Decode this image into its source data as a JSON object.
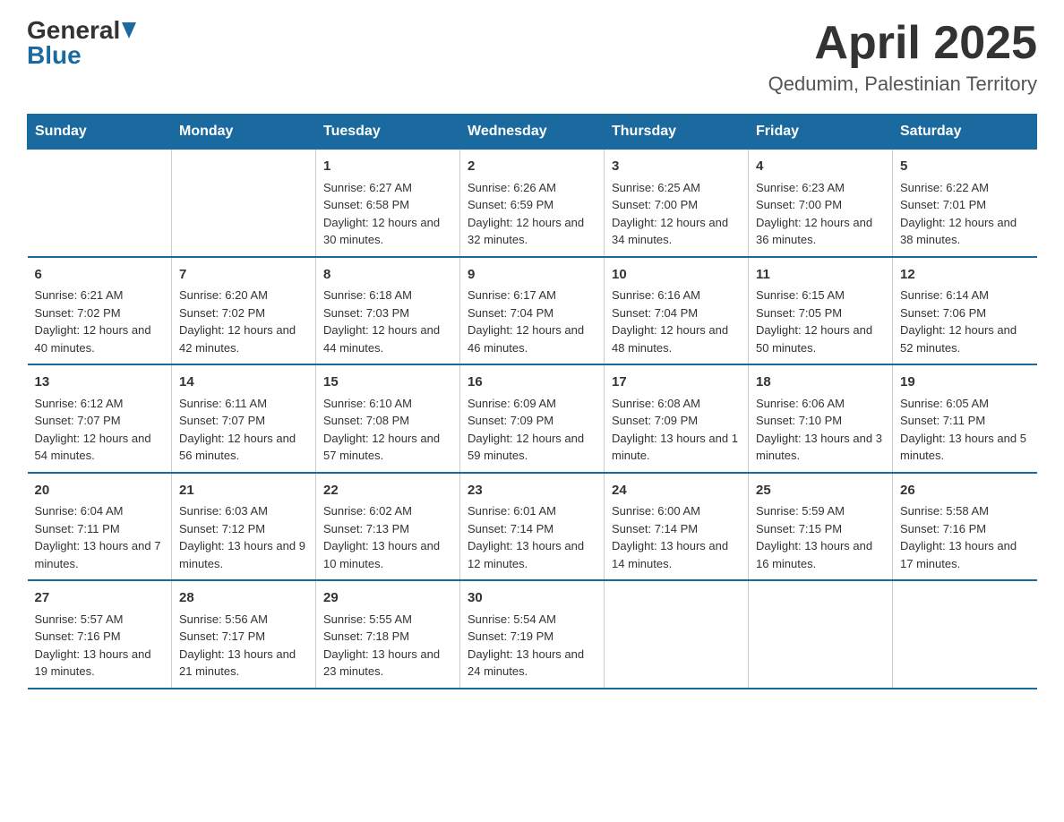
{
  "header": {
    "logo_general": "General",
    "logo_blue": "Blue",
    "month_title": "April 2025",
    "location": "Qedumim, Palestinian Territory"
  },
  "days_of_week": [
    "Sunday",
    "Monday",
    "Tuesday",
    "Wednesday",
    "Thursday",
    "Friday",
    "Saturday"
  ],
  "weeks": [
    [
      {
        "day": "",
        "info": ""
      },
      {
        "day": "",
        "info": ""
      },
      {
        "day": "1",
        "sunrise": "Sunrise: 6:27 AM",
        "sunset": "Sunset: 6:58 PM",
        "daylight": "Daylight: 12 hours and 30 minutes."
      },
      {
        "day": "2",
        "sunrise": "Sunrise: 6:26 AM",
        "sunset": "Sunset: 6:59 PM",
        "daylight": "Daylight: 12 hours and 32 minutes."
      },
      {
        "day": "3",
        "sunrise": "Sunrise: 6:25 AM",
        "sunset": "Sunset: 7:00 PM",
        "daylight": "Daylight: 12 hours and 34 minutes."
      },
      {
        "day": "4",
        "sunrise": "Sunrise: 6:23 AM",
        "sunset": "Sunset: 7:00 PM",
        "daylight": "Daylight: 12 hours and 36 minutes."
      },
      {
        "day": "5",
        "sunrise": "Sunrise: 6:22 AM",
        "sunset": "Sunset: 7:01 PM",
        "daylight": "Daylight: 12 hours and 38 minutes."
      }
    ],
    [
      {
        "day": "6",
        "sunrise": "Sunrise: 6:21 AM",
        "sunset": "Sunset: 7:02 PM",
        "daylight": "Daylight: 12 hours and 40 minutes."
      },
      {
        "day": "7",
        "sunrise": "Sunrise: 6:20 AM",
        "sunset": "Sunset: 7:02 PM",
        "daylight": "Daylight: 12 hours and 42 minutes."
      },
      {
        "day": "8",
        "sunrise": "Sunrise: 6:18 AM",
        "sunset": "Sunset: 7:03 PM",
        "daylight": "Daylight: 12 hours and 44 minutes."
      },
      {
        "day": "9",
        "sunrise": "Sunrise: 6:17 AM",
        "sunset": "Sunset: 7:04 PM",
        "daylight": "Daylight: 12 hours and 46 minutes."
      },
      {
        "day": "10",
        "sunrise": "Sunrise: 6:16 AM",
        "sunset": "Sunset: 7:04 PM",
        "daylight": "Daylight: 12 hours and 48 minutes."
      },
      {
        "day": "11",
        "sunrise": "Sunrise: 6:15 AM",
        "sunset": "Sunset: 7:05 PM",
        "daylight": "Daylight: 12 hours and 50 minutes."
      },
      {
        "day": "12",
        "sunrise": "Sunrise: 6:14 AM",
        "sunset": "Sunset: 7:06 PM",
        "daylight": "Daylight: 12 hours and 52 minutes."
      }
    ],
    [
      {
        "day": "13",
        "sunrise": "Sunrise: 6:12 AM",
        "sunset": "Sunset: 7:07 PM",
        "daylight": "Daylight: 12 hours and 54 minutes."
      },
      {
        "day": "14",
        "sunrise": "Sunrise: 6:11 AM",
        "sunset": "Sunset: 7:07 PM",
        "daylight": "Daylight: 12 hours and 56 minutes."
      },
      {
        "day": "15",
        "sunrise": "Sunrise: 6:10 AM",
        "sunset": "Sunset: 7:08 PM",
        "daylight": "Daylight: 12 hours and 57 minutes."
      },
      {
        "day": "16",
        "sunrise": "Sunrise: 6:09 AM",
        "sunset": "Sunset: 7:09 PM",
        "daylight": "Daylight: 12 hours and 59 minutes."
      },
      {
        "day": "17",
        "sunrise": "Sunrise: 6:08 AM",
        "sunset": "Sunset: 7:09 PM",
        "daylight": "Daylight: 13 hours and 1 minute."
      },
      {
        "day": "18",
        "sunrise": "Sunrise: 6:06 AM",
        "sunset": "Sunset: 7:10 PM",
        "daylight": "Daylight: 13 hours and 3 minutes."
      },
      {
        "day": "19",
        "sunrise": "Sunrise: 6:05 AM",
        "sunset": "Sunset: 7:11 PM",
        "daylight": "Daylight: 13 hours and 5 minutes."
      }
    ],
    [
      {
        "day": "20",
        "sunrise": "Sunrise: 6:04 AM",
        "sunset": "Sunset: 7:11 PM",
        "daylight": "Daylight: 13 hours and 7 minutes."
      },
      {
        "day": "21",
        "sunrise": "Sunrise: 6:03 AM",
        "sunset": "Sunset: 7:12 PM",
        "daylight": "Daylight: 13 hours and 9 minutes."
      },
      {
        "day": "22",
        "sunrise": "Sunrise: 6:02 AM",
        "sunset": "Sunset: 7:13 PM",
        "daylight": "Daylight: 13 hours and 10 minutes."
      },
      {
        "day": "23",
        "sunrise": "Sunrise: 6:01 AM",
        "sunset": "Sunset: 7:14 PM",
        "daylight": "Daylight: 13 hours and 12 minutes."
      },
      {
        "day": "24",
        "sunrise": "Sunrise: 6:00 AM",
        "sunset": "Sunset: 7:14 PM",
        "daylight": "Daylight: 13 hours and 14 minutes."
      },
      {
        "day": "25",
        "sunrise": "Sunrise: 5:59 AM",
        "sunset": "Sunset: 7:15 PM",
        "daylight": "Daylight: 13 hours and 16 minutes."
      },
      {
        "day": "26",
        "sunrise": "Sunrise: 5:58 AM",
        "sunset": "Sunset: 7:16 PM",
        "daylight": "Daylight: 13 hours and 17 minutes."
      }
    ],
    [
      {
        "day": "27",
        "sunrise": "Sunrise: 5:57 AM",
        "sunset": "Sunset: 7:16 PM",
        "daylight": "Daylight: 13 hours and 19 minutes."
      },
      {
        "day": "28",
        "sunrise": "Sunrise: 5:56 AM",
        "sunset": "Sunset: 7:17 PM",
        "daylight": "Daylight: 13 hours and 21 minutes."
      },
      {
        "day": "29",
        "sunrise": "Sunrise: 5:55 AM",
        "sunset": "Sunset: 7:18 PM",
        "daylight": "Daylight: 13 hours and 23 minutes."
      },
      {
        "day": "30",
        "sunrise": "Sunrise: 5:54 AM",
        "sunset": "Sunset: 7:19 PM",
        "daylight": "Daylight: 13 hours and 24 minutes."
      },
      {
        "day": "",
        "info": ""
      },
      {
        "day": "",
        "info": ""
      },
      {
        "day": "",
        "info": ""
      }
    ]
  ]
}
